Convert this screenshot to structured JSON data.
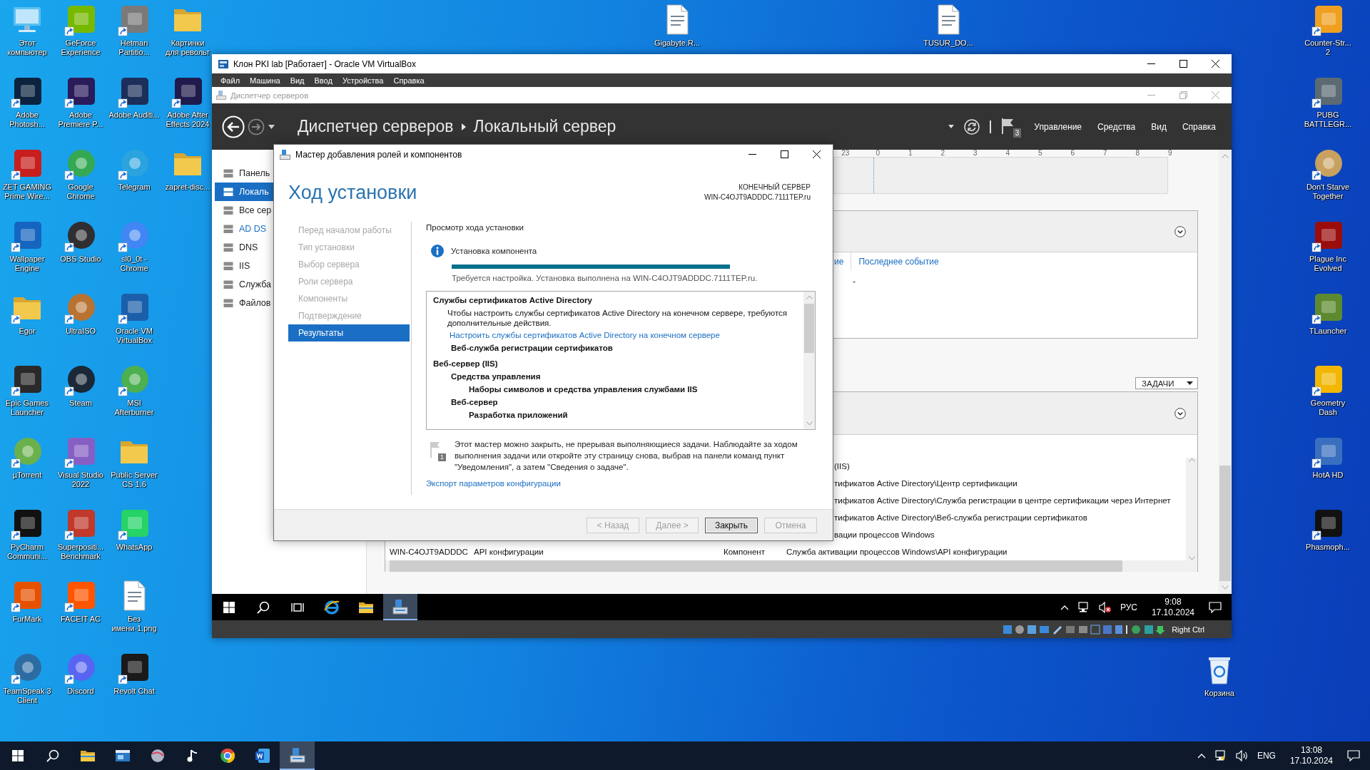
{
  "desktop": {
    "left_icons": [
      {
        "label": "Этот компьютер",
        "kind": "computer",
        "color": "#5bc0f0",
        "shortcut": false
      },
      {
        "label": "Adobe Photosh...",
        "kind": "app",
        "color": "#0c2340",
        "shortcut": true
      },
      {
        "label": "ZET GAMING Prime Wire...",
        "kind": "app",
        "color": "#c81e1e",
        "shortcut": true
      },
      {
        "label": "Wallpaper Engine",
        "kind": "app",
        "color": "#1565c0",
        "shortcut": true
      },
      {
        "label": "Egor",
        "kind": "folder",
        "color": "#f2c94c",
        "shortcut": true
      },
      {
        "label": "Epic Games Launcher",
        "kind": "app",
        "color": "#2a2a2a",
        "shortcut": true
      },
      {
        "label": "µTorrent",
        "kind": "round",
        "color": "#6ab04c",
        "shortcut": true
      },
      {
        "label": "PyCharm Communi...",
        "kind": "app",
        "color": "#111111",
        "shortcut": true
      },
      {
        "label": "FurMark",
        "kind": "app",
        "color": "#e65100",
        "shortcut": true
      },
      {
        "label": "TeamSpeak 3 Client",
        "kind": "round",
        "color": "#2b6ca3",
        "shortcut": true
      },
      {
        "label": "GeForce Experience",
        "kind": "app",
        "color": "#76b900",
        "shortcut": true
      },
      {
        "label": "Adobe Premiere P...",
        "kind": "app",
        "color": "#2a1b5a",
        "shortcut": true
      },
      {
        "label": "Google Chrome",
        "kind": "round",
        "color": "#34a853",
        "shortcut": true
      },
      {
        "label": "OBS Studio",
        "kind": "round",
        "color": "#302e31",
        "shortcut": true
      },
      {
        "label": "UltraISO",
        "kind": "round",
        "color": "#b87333",
        "shortcut": true
      },
      {
        "label": "Steam",
        "kind": "round",
        "color": "#1b2838",
        "shortcut": true
      },
      {
        "label": "Visual Studio 2022",
        "kind": "app",
        "color": "#865fc5",
        "shortcut": true
      },
      {
        "label": "Superpositi... Benchmark",
        "kind": "app",
        "color": "#c0392b",
        "shortcut": true
      },
      {
        "label": "FACEIT AC",
        "kind": "app",
        "color": "#ff5500",
        "shortcut": true
      },
      {
        "label": "Discord",
        "kind": "round",
        "color": "#5865f2",
        "shortcut": true
      },
      {
        "label": "Hetman Partitio...",
        "kind": "app",
        "color": "#7a7a7a",
        "shortcut": true
      },
      {
        "label": "Adobe Auditi...",
        "kind": "app",
        "color": "#1c2e5a",
        "shortcut": true
      },
      {
        "label": "Telegram",
        "kind": "round",
        "color": "#2aa3df",
        "shortcut": true
      },
      {
        "label": "sl0_0t - Chrome",
        "kind": "round",
        "color": "#4285f4",
        "shortcut": true
      },
      {
        "label": "Oracle VM VirtualBox",
        "kind": "app",
        "color": "#1b5faa",
        "shortcut": true
      },
      {
        "label": "MSI Afterburner",
        "kind": "round",
        "color": "#4caf50",
        "shortcut": true
      },
      {
        "label": "Public Server CS 1.6",
        "kind": "folder",
        "color": "#f2c94c",
        "shortcut": false
      },
      {
        "label": "WhatsApp",
        "kind": "app",
        "color": "#25d366",
        "shortcut": true
      },
      {
        "label": "Без имени-1.png",
        "kind": "file",
        "color": "#ffffff",
        "shortcut": false
      },
      {
        "label": "Revolt Chat",
        "kind": "app",
        "color": "#1a1a1a",
        "shortcut": true
      },
      {
        "label": "Картинки для револьт",
        "kind": "folder",
        "color": "#f2c94c",
        "shortcut": false
      },
      {
        "label": "Adobe After Effects 2024",
        "kind": "app",
        "color": "#1f1b4d",
        "shortcut": true
      },
      {
        "label": "zapret-disc...",
        "kind": "folder",
        "color": "#f2c94c",
        "shortcut": false
      }
    ],
    "top_icons": [
      {
        "label": "Gigabyte.R...",
        "kind": "file",
        "color": "#ffffff",
        "shortcut": false
      },
      {
        "label": "TUSUR_DO...",
        "kind": "file",
        "color": "#ffffff",
        "shortcut": false
      }
    ],
    "right_icons": [
      {
        "label": "Counter-Str... 2",
        "kind": "app",
        "color": "#f0a020",
        "shortcut": true
      },
      {
        "label": "PUBG BATTLEGR...",
        "kind": "app",
        "color": "#5b6a73",
        "shortcut": true
      },
      {
        "label": "Don't Starve Together",
        "kind": "round",
        "color": "#c8a060",
        "shortcut": true
      },
      {
        "label": "Plague Inc Evolved",
        "kind": "app",
        "color": "#9b0d0d",
        "shortcut": true
      },
      {
        "label": "TLauncher",
        "kind": "app",
        "color": "#5d8a2f",
        "shortcut": true
      },
      {
        "label": "Geometry Dash",
        "kind": "app",
        "color": "#f2b705",
        "shortcut": true
      },
      {
        "label": "HotA HD",
        "kind": "app",
        "color": "#3a6fbf",
        "shortcut": true
      },
      {
        "label": "Phasmoph...",
        "kind": "app",
        "color": "#111111",
        "shortcut": true
      }
    ],
    "recycle_bin": {
      "label": "Корзина",
      "kind": "bin",
      "color": "#e8f1fb"
    }
  },
  "vbox": {
    "title": "Клон PKI lab [Работает] - Oracle VM VirtualBox",
    "menu": [
      "Файл",
      "Машина",
      "Вид",
      "Ввод",
      "Устройства",
      "Справка"
    ],
    "host_key": "Right Ctrl"
  },
  "server_manager": {
    "window_title": "Диспетчер серверов",
    "breadcrumb": [
      "Диспетчер серверов",
      "Локальный сервер"
    ],
    "notification_count": "3",
    "menu": [
      "Управление",
      "Средства",
      "Вид",
      "Справка"
    ],
    "nav": [
      {
        "label": "Панель",
        "selected": false,
        "attention": false
      },
      {
        "label": "Локаль",
        "selected": true,
        "attention": false
      },
      {
        "label": "Все сер",
        "selected": false,
        "attention": false
      },
      {
        "label": "AD DS",
        "selected": false,
        "attention": true
      },
      {
        "label": "DNS",
        "selected": false,
        "attention": false
      },
      {
        "label": "IIS",
        "selected": false,
        "attention": false
      },
      {
        "label": "Служба",
        "selected": false,
        "attention": false
      },
      {
        "label": "Файлов",
        "selected": false,
        "attention": false
      }
    ],
    "timeline_ticks": [
      "23",
      "0",
      "1",
      "2",
      "3",
      "4",
      "5",
      "6",
      "7",
      "8",
      "9"
    ],
    "events_panel": {
      "columns": [
        "ие",
        "Последнее событие"
      ],
      "rows": [
        [
          "-"
        ]
      ]
    },
    "tasks_button": "ЗАДАЧИ",
    "components_panel": {
      "rows": [
        {
          "tail": "(IIS)"
        },
        {
          "tail": "тификатов Active Directory\\Центр сертификации"
        },
        {
          "tail": "тификатов Active Directory\\Служба регистрации в центре сертификации через Интернет"
        },
        {
          "tail": "тификатов Active Directory\\Веб-служба регистрации сертификатов"
        },
        {
          "tail": "вации процессов Windows"
        },
        {
          "cells": [
            "WIN-C4OJT9ADDDC",
            "API конфигурации",
            "Компонент",
            "Служба активации процессов Windows\\API конфигурации"
          ]
        }
      ]
    }
  },
  "wizard": {
    "title": "Мастер добавления ролей и компонентов",
    "heading": "Ход установки",
    "target_label": "КОНЕЧНЫЙ СЕРВЕР",
    "target_server": "WIN-C4OJT9ADDDC.7111TEP.ru",
    "steps": [
      {
        "label": "Перед началом работы",
        "selected": false
      },
      {
        "label": "Тип установки",
        "selected": false
      },
      {
        "label": "Выбор сервера",
        "selected": false
      },
      {
        "label": "Роли сервера",
        "selected": false
      },
      {
        "label": "Компоненты",
        "selected": false
      },
      {
        "label": "Подтверждение",
        "selected": false
      },
      {
        "label": "Результаты",
        "selected": true
      }
    ],
    "section_title": "Просмотр хода установки",
    "status": {
      "label": "Установка компонента",
      "level": 1.0,
      "message": "Требуется настройка. Установка выполнена на WIN-C4OJT9ADDDC.7111TEP.ru."
    },
    "results": [
      {
        "kind": "heading",
        "text": "Службы сертификатов Active Directory",
        "children": [
          {
            "kind": "note",
            "text": "Чтобы настроить службы сертификатов Active Directory на конечном сервере, требуются дополнительные действия."
          },
          {
            "kind": "link",
            "text": "Настроить службы сертификатов Active Directory на конечном сервере"
          },
          {
            "kind": "heading",
            "text": "Веб-служба регистрации сертификатов"
          }
        ]
      },
      {
        "kind": "heading",
        "text": "Веб-сервер (IIS)",
        "children": [
          {
            "kind": "heading",
            "text": "Средства управления",
            "children": [
              {
                "kind": "heading",
                "text": "Наборы символов и средства управления службами IIS"
              }
            ]
          },
          {
            "kind": "heading",
            "text": "Веб-сервер",
            "children": [
              {
                "kind": "heading",
                "text": "Разработка приложений"
              }
            ]
          }
        ]
      }
    ],
    "notice": "Этот мастер можно закрыть, не прерывая выполняющиеся задачи. Наблюдайте за ходом выполнения задачи или откройте эту страницу снова, выбрав на панели команд пункт \"Уведомления\", а затем \"Сведения о задаче\".",
    "notice_count": "1",
    "export_link": "Экспорт параметров конфигурации",
    "buttons": [
      {
        "label": "< Назад",
        "disabled": true,
        "default": false
      },
      {
        "label": "Далее >",
        "disabled": true,
        "default": false
      },
      {
        "label": "Закрыть",
        "disabled": false,
        "default": true
      },
      {
        "label": "Отмена",
        "disabled": true,
        "default": false
      }
    ]
  },
  "vm_taskbar": {
    "apps": [
      {
        "kind": "start",
        "selected": false
      },
      {
        "kind": "search",
        "selected": false
      },
      {
        "kind": "task_view",
        "selected": false
      },
      {
        "kind": "browser",
        "selected": false
      },
      {
        "kind": "explorer",
        "selected": false
      },
      {
        "kind": "server_manager",
        "selected": true
      }
    ],
    "muted": true,
    "language": "РУС",
    "time": "9:08",
    "date": "17.10.2024"
  },
  "host_taskbar": {
    "apps": [
      {
        "kind": "start",
        "selected": false
      },
      {
        "kind": "search",
        "selected": false
      },
      {
        "kind": "explorer",
        "selected": false
      },
      {
        "kind": "window",
        "selected": false
      },
      {
        "kind": "ball",
        "selected": false
      },
      {
        "kind": "music",
        "selected": false
      },
      {
        "kind": "chrome",
        "selected": false
      },
      {
        "kind": "word",
        "selected": false
      },
      {
        "kind": "server_manager",
        "selected": true
      }
    ],
    "muted": false,
    "language": "ENG",
    "time": "13:08",
    "date": "17.10.2024"
  }
}
